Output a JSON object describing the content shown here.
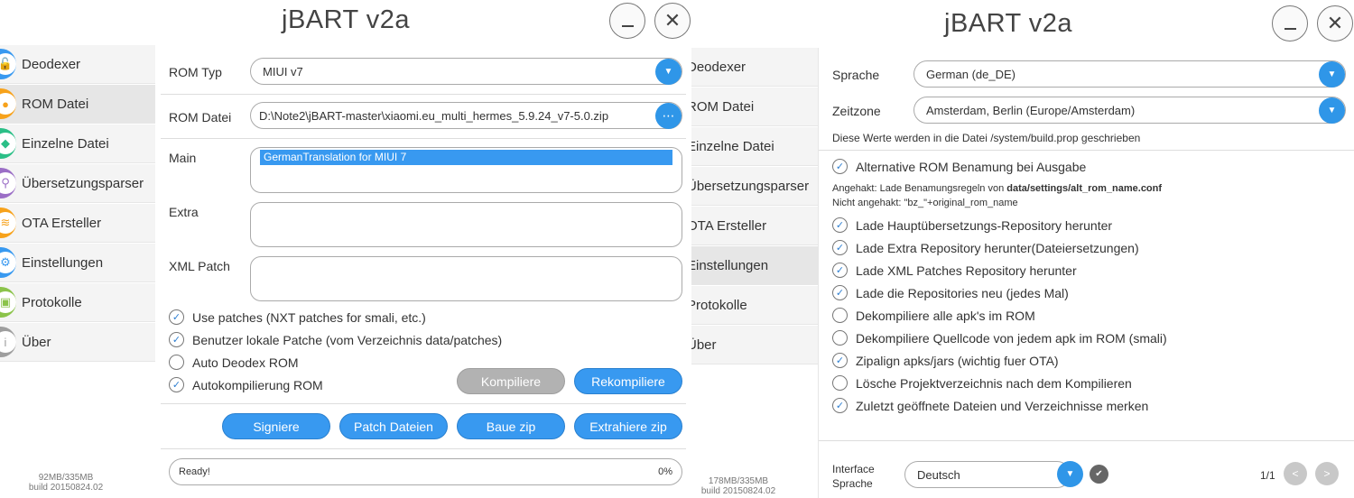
{
  "left": {
    "title": "jBART v2a",
    "nav": [
      {
        "label": "Deodexer",
        "icon": "unlock-icon",
        "color": "#3899f0"
      },
      {
        "label": "ROM Datei",
        "icon": "rom-file-icon",
        "color": "#f7a21b"
      },
      {
        "label": "Einzelne Datei",
        "icon": "android-icon",
        "color": "#2bbf87"
      },
      {
        "label": "Übersetzungsparser",
        "icon": "key-icon",
        "color": "#9b6ec6"
      },
      {
        "label": "OTA Ersteller",
        "icon": "ota-icon",
        "color": "#f7a21b"
      },
      {
        "label": "Einstellungen",
        "icon": "gear-icon",
        "color": "#3899f0"
      },
      {
        "label": "Protokolle",
        "icon": "log-icon",
        "color": "#8bc34a"
      },
      {
        "label": "Über",
        "icon": "info-icon",
        "color": "#9e9e9e"
      }
    ],
    "status_mem": "92MB/335MB",
    "status_build": "build 20150824.02",
    "rom_typ_label": "ROM Typ",
    "rom_typ_value": "MIUI v7",
    "rom_datei_label": "ROM Datei",
    "rom_datei_value": "D:\\Note2\\jBART-master\\xiaomi.eu_multi_hermes_5.9.24_v7-5.0.zip",
    "main_label": "Main",
    "main_selected": "GermanTranslation for MIUI 7",
    "extra_label": "Extra",
    "xml_patch_label": "XML Patch",
    "checks": [
      {
        "label": "Use patches (NXT patches for smali, etc.)",
        "checked": true
      },
      {
        "label": "Benutzer lokale Patche (vom Verzeichnis data/patches)",
        "checked": true
      },
      {
        "label": "Auto Deodex ROM",
        "checked": false
      },
      {
        "label": "Autokompilierung ROM",
        "checked": true
      }
    ],
    "btn_kompiliere": "Kompiliere",
    "btn_rekompiliere": "Rekompiliere",
    "btn_signiere": "Signiere",
    "btn_patch": "Patch Dateien",
    "btn_baue": "Baue zip",
    "btn_extrahiere": "Extrahiere zip",
    "progress_text": "Ready!",
    "progress_pct": "0%",
    "progress_value": 0
  },
  "right": {
    "title": "jBART v2a",
    "nav": [
      {
        "label": "Deodexer"
      },
      {
        "label": "ROM Datei"
      },
      {
        "label": "Einzelne Datei"
      },
      {
        "label": "Übersetzungsparser"
      },
      {
        "label": "OTA Ersteller"
      },
      {
        "label": "Einstellungen"
      },
      {
        "label": "Protokolle"
      },
      {
        "label": "Über"
      }
    ],
    "status_mem": "178MB/335MB",
    "status_build": "build 20150824.02",
    "sprache_label": "Sprache",
    "sprache_value": "German (de_DE)",
    "zeitzone_label": "Zeitzone",
    "zeitzone_value": "Amsterdam, Berlin (Europe/Amsterdam)",
    "buildprop_note": "Diese Werte werden in die Datei /system/build.prop geschrieben",
    "alt_rom_label": "Alternative ROM Benamung bei Ausgabe",
    "alt_rom_checked": true,
    "note_checked_prefix": "Angehakt: Lade Benamungsregeln von ",
    "note_checked_path": "data/settings/alt_rom_name.conf",
    "note_unchecked": "Nicht angehakt: \"bz_\"+original_rom_name",
    "checks": [
      {
        "label": "Lade Hauptübersetzungs-Repository herunter",
        "checked": true
      },
      {
        "label": "Lade Extra Repository herunter(Dateiersetzungen)",
        "checked": true
      },
      {
        "label": "Lade XML Patches Repository herunter",
        "checked": true
      },
      {
        "label": "Lade die Repositories neu (jedes Mal)",
        "checked": true
      },
      {
        "label": "Dekompiliere alle apk's im ROM",
        "checked": false
      },
      {
        "label": "Dekompiliere Quellcode von jedem apk im ROM (smali)",
        "checked": false
      },
      {
        "label": "Zipalign apks/jars (wichtig fuer OTA)",
        "checked": true
      },
      {
        "label": "Lösche Projektverzeichnis nach dem Kompilieren",
        "checked": false
      },
      {
        "label": "Zuletzt geöffnete Dateien und Verzeichnisse merken",
        "checked": true
      }
    ],
    "interface_label_1": "Interface",
    "interface_label_2": "Sprache",
    "interface_value": "Deutsch",
    "pager": "1/1",
    "pager_prev": "<",
    "pager_next": ">"
  }
}
